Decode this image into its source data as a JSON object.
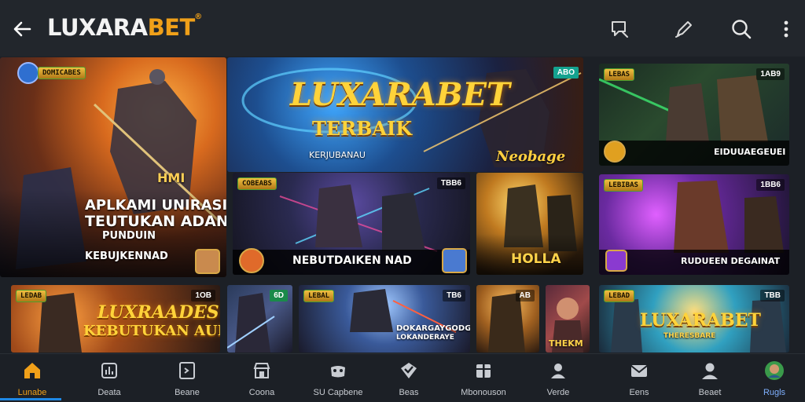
{
  "header": {
    "logo_main": "LUXARA",
    "logo_accent": "BET",
    "logo_mark": "®",
    "icons": [
      "back-arrow-icon",
      "chat-icon",
      "pen-icon",
      "search-icon",
      "more-vertical-icon"
    ]
  },
  "tiles": {
    "t1": {
      "badge": "DOMICABES",
      "caption1": "APLKAMI UNIRASI",
      "caption2": "TEUTUKAN ADAN",
      "caption3": "PUNDUIN",
      "caption4": "KEBUJKENNAD",
      "corner": "HMI"
    },
    "t2": {
      "title": "LUXARABET",
      "subtitle": "TERBAIK",
      "tagline": "KERJUBANAU",
      "corner": "ABO",
      "brand": "Neobage"
    },
    "t3": {
      "badge": "LEBAS",
      "corner": "1AB9",
      "caption": "EIDUUAEGEUEI"
    },
    "t4": {
      "badge": "COBEABS",
      "corner": "TBB6",
      "caption": "NEBUTDAIKEN NAD"
    },
    "t5": {
      "caption": "HOLLA"
    },
    "t6": {
      "badge": "LEBIBAS",
      "corner": "1BB6",
      "caption": "RUDUEEN DEGAINAT"
    },
    "t7": {
      "badge": "LEDAB",
      "corner": "1OB",
      "title1": "LUXRAADES",
      "title2": "KEBUTUKAN AUD"
    },
    "t8": {
      "corner": "6D"
    },
    "t9": {
      "badge": "LEBAL",
      "corner": "TB6",
      "caption1": "DOKARGAYGODG",
      "caption2": "LOKANDERAYE"
    },
    "t10": {
      "corner": "AB"
    },
    "t11": {
      "caption": "THEKM"
    },
    "t12": {
      "badge": "LEBAD",
      "corner": "TBB",
      "title": "LUXARABET",
      "subtitle": "THERESBARE"
    }
  },
  "nav": {
    "items": [
      {
        "label": "Lunabe",
        "icon": "home-icon"
      },
      {
        "label": "Deata",
        "icon": "chart-icon"
      },
      {
        "label": "Beane",
        "icon": "tablet-icon"
      },
      {
        "label": "Coona",
        "icon": "store-icon"
      },
      {
        "label": "SU Capbene",
        "icon": "gamepad-icon"
      },
      {
        "label": "Beas",
        "icon": "shield-check-icon"
      },
      {
        "label": "Mbonouson",
        "icon": "gift-icon"
      },
      {
        "label": "Verde",
        "icon": "user-icon"
      },
      {
        "label": "Eens",
        "icon": "mail-icon"
      },
      {
        "label": "Beaet",
        "icon": "profile-icon"
      },
      {
        "label": "Rugls",
        "icon": "avatar-icon"
      }
    ],
    "active_index": 0
  },
  "colors": {
    "accent": "#f0a019",
    "active_underline": "#1e88e5",
    "background": "#1c2026"
  }
}
